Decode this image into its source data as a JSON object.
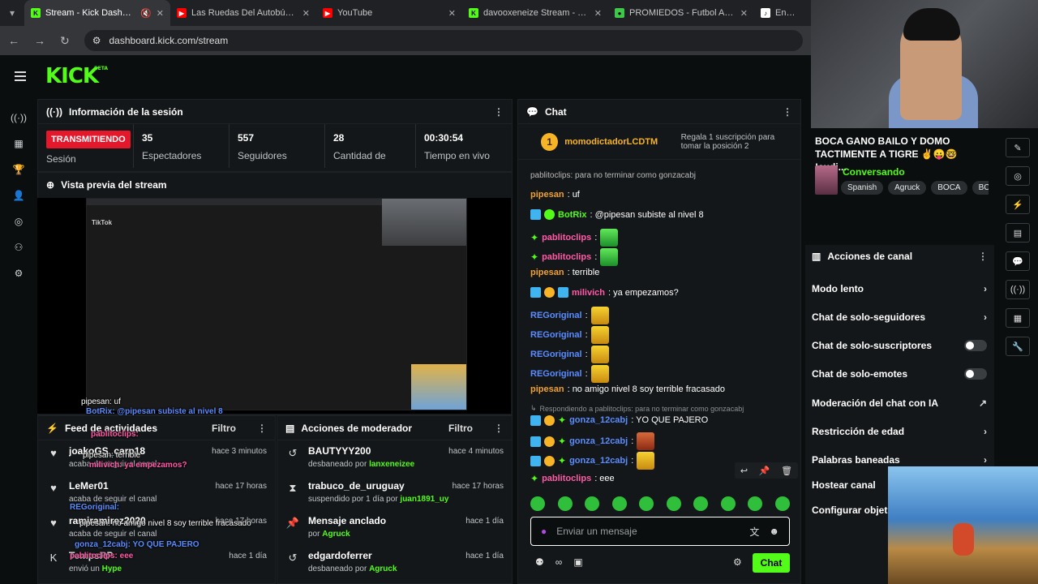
{
  "browser": {
    "tabs": [
      {
        "title": "Stream - Kick Dashboard",
        "active": true,
        "favicon": "kick-icon",
        "color": "#53fc18"
      },
      {
        "title": "Las Ruedas Del Autobús ¡Nu",
        "active": false,
        "favicon": "youtube-icon",
        "color": "#ff0000"
      },
      {
        "title": "YouTube",
        "active": false,
        "favicon": "youtube-icon",
        "color": "#ff0000"
      },
      {
        "title": "davooxeneize Stream - Wat",
        "active": false,
        "favicon": "kick-icon",
        "color": "#53fc18"
      },
      {
        "title": "PROMIEDOS - Futbol Argent",
        "active": false,
        "favicon": "promiedos-icon",
        "color": "#3ec84a"
      },
      {
        "title": "Encuentra",
        "active": false,
        "favicon": "tiktok-icon",
        "color": "#ffffff"
      }
    ],
    "url": "dashboard.kick.com/stream"
  },
  "header": {
    "logo": "KICK",
    "logo_sup": "BETA"
  },
  "session": {
    "title": "Información de la sesión",
    "live_label": "TRANSMITIENDO",
    "session_label": "Sesión",
    "stats": [
      {
        "value": "35",
        "label": "Espectadores"
      },
      {
        "value": "557",
        "label": "Seguidores"
      },
      {
        "value": "28",
        "label": "Cantidad de"
      },
      {
        "value": "00:30:54",
        "label": "Tiempo en vivo"
      }
    ]
  },
  "preview": {
    "title": "Vista previa del stream",
    "tiktok_label": "TikTok"
  },
  "activity": {
    "title": "Feed de actividades",
    "filter": "Filtro",
    "items": [
      {
        "name": "joakoGS_carp18",
        "sub": "acaba de seguir el canal",
        "time": "hace 3 minutos"
      },
      {
        "name": "LeMer01",
        "sub": "acaba de seguir el canal",
        "time": "hace 17 horas"
      },
      {
        "name": "ramiramirez2020",
        "sub": "acaba de seguir el canal",
        "time": "hace 17 horas"
      },
      {
        "name": "TempsRP",
        "sub": "envió un",
        "sub_highlight": "Hype",
        "time": "hace 1 día"
      }
    ]
  },
  "moderator": {
    "title": "Acciones de moderador",
    "filter": "Filtro",
    "items": [
      {
        "name": "BAUTYYY200",
        "sub": "desbaneado por",
        "by": "lanxeneizee",
        "time": "hace 4 minutos",
        "icon": "undo-icon"
      },
      {
        "name": "trabuco_de_uruguay",
        "sub": "suspendido por 1 día por",
        "by": "juan1891_uy",
        "time": "hace 17 horas",
        "icon": "hourglass-icon"
      },
      {
        "name": "Mensaje anclado",
        "sub": "por",
        "by": "Agruck",
        "time": "hace 1 día",
        "icon": "pin-icon"
      },
      {
        "name": "edgardoferrer",
        "sub": "desbaneado por",
        "by": "Agruck",
        "time": "hace 1 día",
        "icon": "undo-icon"
      }
    ]
  },
  "chat": {
    "title": "Chat",
    "top_gifter": {
      "name": "momodictadorLCDTM",
      "rank": "1",
      "promo": "Regala 1 suscripción para tomar la posición 2"
    },
    "pinned_partial": "pablitoclips: para no terminar como gonzacabj",
    "messages": [
      {
        "user": "pipesan",
        "color": "#f0a030",
        "text": ": uf"
      },
      {
        "user": "BotRix",
        "color": "#53fc18",
        "text": ": @pipesan subiste al nivel 8"
      },
      {
        "user": "pablitoclips",
        "color": "#ff5aa8",
        "text": ":"
      },
      {
        "user": "pablitoclips",
        "color": "#ff5aa8",
        "text": ":"
      },
      {
        "user": "pipesan",
        "color": "#f0a030",
        "text": ": terrible"
      },
      {
        "user": "milivich",
        "color": "#ff5aa8",
        "text": ": ya empezamos?"
      },
      {
        "user": "REGoriginal",
        "color": "#5a8cff",
        "text": ":"
      },
      {
        "user": "REGoriginal",
        "color": "#5a8cff",
        "text": ":"
      },
      {
        "user": "REGoriginal",
        "color": "#5a8cff",
        "text": ":"
      },
      {
        "user": "REGoriginal",
        "color": "#5a8cff",
        "text": ":"
      },
      {
        "user": "pipesan",
        "color": "#f0a030",
        "text": ": no amigo nivel 8 soy terrible fracasado"
      },
      {
        "user": "gonza_12cabj",
        "color": "#5a8cff",
        "text": ": YO QUE PAJERO"
      },
      {
        "user": "gonza_12cabj",
        "color": "#5a8cff",
        "text": ":"
      },
      {
        "user": "gonza_12cabj",
        "color": "#5a8cff",
        "text": ":"
      },
      {
        "user": "pablitoclips",
        "color": "#ff5aa8",
        "text": ": eee"
      }
    ],
    "reply_note": "Respondiendo a pablitoclips: para no terminar como gonzacabj",
    "input_placeholder": "Enviar un mensaje",
    "send_label": "Chat"
  },
  "stream": {
    "title": "BOCA GANO BAILO Y DOMO TACTIMENTE A TIGRE ✌😛🤓 !audi...",
    "category": "Conversando",
    "tags": [
      "Spanish",
      "Agruck",
      "BOCA",
      "BC"
    ]
  },
  "channel_actions": {
    "title": "Acciones de canal",
    "items": [
      {
        "label": "Modo lento",
        "type": "chevron"
      },
      {
        "label": "Chat de solo-seguidores",
        "type": "chevron"
      },
      {
        "label": "Chat de solo-suscriptores",
        "type": "toggle"
      },
      {
        "label": "Chat de solo-emotes",
        "type": "toggle"
      },
      {
        "label": "Moderación del chat con IA",
        "type": "external"
      },
      {
        "label": "Restricción de edad",
        "type": "chevron"
      },
      {
        "label": "Palabras baneadas",
        "type": "chevron"
      },
      {
        "label": "Hostear canal",
        "type": "none"
      },
      {
        "label": "Configurar objeti",
        "type": "none"
      }
    ]
  },
  "overlay_chat": {
    "lines": [
      "pipesan: uf",
      "BotRix: @pipesan subiste al nivel 8",
      "pablitoclips:",
      "pipesan: terrible",
      "milivich: ya empezamos?",
      "REGoriginal:",
      "pipesan: no amigo nivel 8 soy terrible fracasado",
      "gonza_12cabj: YO QUE PAJERO",
      "pablitoclips: eee"
    ]
  }
}
